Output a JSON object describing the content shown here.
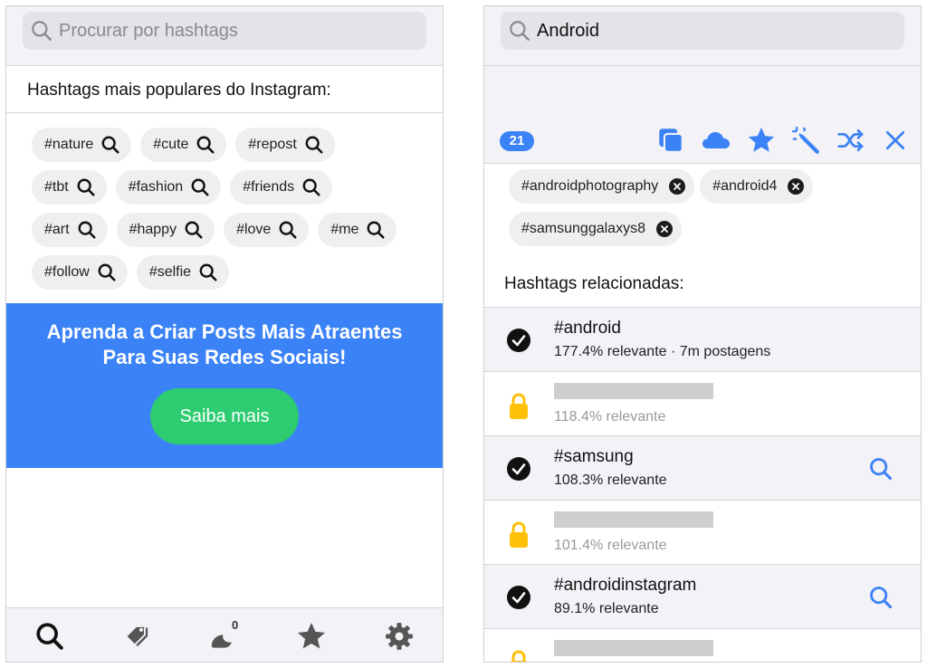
{
  "left": {
    "search_placeholder": "Procurar por hashtags",
    "section_title": "Hashtags mais populares do Instagram:",
    "chip_rows": [
      [
        "#nature",
        "#cute",
        "#repost"
      ],
      [
        "#tbt",
        "#fashion",
        "#friends"
      ],
      [
        "#art",
        "#happy",
        "#love",
        "#me"
      ],
      [
        "#follow",
        "#selfie"
      ]
    ],
    "promo": {
      "line1": "Aprenda a Criar Posts Mais Atraentes",
      "line2": "Para Suas Redes Sociais!",
      "button": "Saiba mais"
    },
    "tabbar": {
      "tabs": [
        "search-icon",
        "tags-icon",
        "moon-icon",
        "star-icon",
        "gear-icon"
      ],
      "moon_badge": "0"
    }
  },
  "right": {
    "search_value": "Android",
    "selected_count": "21",
    "toolbar_icons": [
      "copy-icon",
      "cloud-icon",
      "star-icon",
      "magic-wand-icon",
      "shuffle-icon",
      "close-icon"
    ],
    "selected_chips": [
      "#androidphotography",
      "#android4",
      "#samsunggalaxys8"
    ],
    "related_title": "Hashtags relacionadas:",
    "related": [
      {
        "name": "#android",
        "meta": "177.4% relevante · 7m postagens",
        "locked": false,
        "search": false
      },
      {
        "name": "",
        "meta": "118.4% relevante",
        "locked": true,
        "search": false
      },
      {
        "name": "#samsung",
        "meta": "108.3% relevante",
        "locked": false,
        "search": true
      },
      {
        "name": "",
        "meta": "101.4% relevante",
        "locked": true,
        "search": false
      },
      {
        "name": "#androidinstagram",
        "meta": "89.1% relevante",
        "locked": false,
        "search": true
      },
      {
        "name": "",
        "meta": "",
        "locked": true,
        "search": false
      }
    ]
  },
  "colors": {
    "accent": "#3b82f6",
    "promo_button": "#2ecc71",
    "lock": "#ffc107",
    "chip_bg": "#efefef"
  }
}
